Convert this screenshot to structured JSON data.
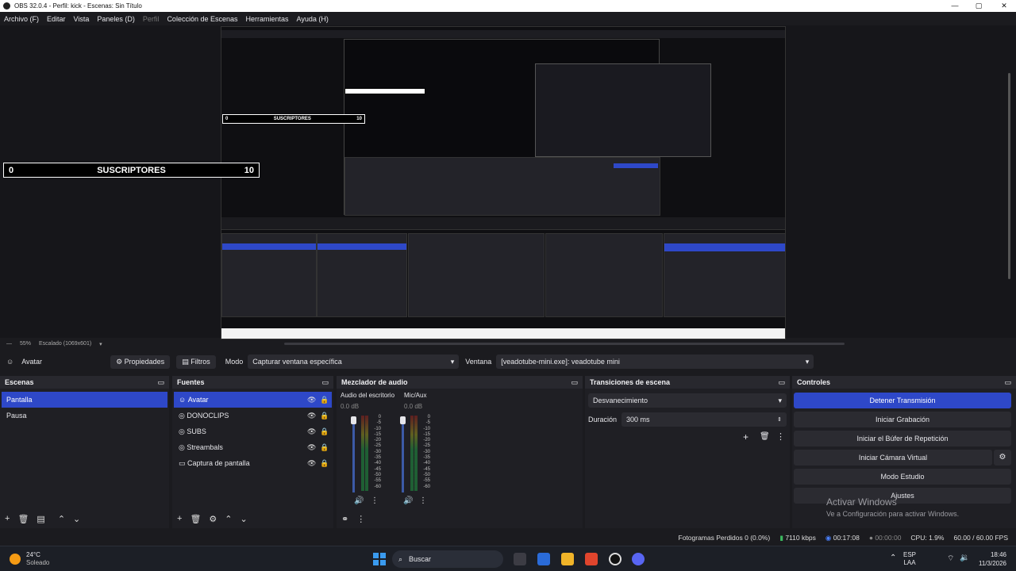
{
  "window": {
    "title": "OBS 32.0.4 - Perfil: kick - Escenas: Sin Título",
    "min": "—",
    "max": "▢",
    "close": "✕"
  },
  "menu": [
    {
      "label": "Archivo (F)"
    },
    {
      "label": "Editar"
    },
    {
      "label": "Vista"
    },
    {
      "label": "Paneles (D)"
    },
    {
      "label": "Perfil"
    },
    {
      "label": "Colección de Escenas"
    },
    {
      "label": "Herramientas"
    },
    {
      "label": "Ayuda (H)"
    }
  ],
  "preview": {
    "subscribers_left": "0",
    "subscribers_label": "SUSCRIPTORES",
    "subscribers_right": "10",
    "zoom": "55%",
    "scaled": "Escalado (1069x601)"
  },
  "source_toolbar": {
    "source_name": "Avatar",
    "properties": "Propiedades",
    "filters": "Filtros",
    "mode_label": "Modo",
    "mode_value": "Capturar ventana específica",
    "window_label": "Ventana",
    "window_value": "[veadotube-mini.exe]: veadotube mini"
  },
  "scenes": {
    "title": "Escenas",
    "items": [
      "Pantalla",
      "Pausa"
    ],
    "selected": 0
  },
  "sources": {
    "title": "Fuentes",
    "items": [
      "Avatar",
      "DONOCLIPS",
      "SUBS",
      "Streambals",
      "Captura de pantalla"
    ],
    "selected": 0
  },
  "mixer": {
    "title": "Mezclador de audio",
    "channels": [
      {
        "name": "Audio del escritorio",
        "db": "0.0 dB"
      },
      {
        "name": "Mic/Aux",
        "db": "0.0 dB"
      }
    ],
    "scale": [
      "0",
      "-5",
      "-10",
      "-15",
      "-20",
      "-25",
      "-30",
      "-35",
      "-40",
      "-45",
      "-50",
      "-55",
      "-60"
    ]
  },
  "transitions": {
    "title": "Transiciones de escena",
    "type": "Desvanecimiento",
    "duration_label": "Duración",
    "duration_value": "300 ms"
  },
  "controls": {
    "title": "Controles",
    "buttons": [
      "Detener Transmisión",
      "Iniciar Grabación",
      "Iniciar el Búfer de Repetición",
      "Iniciar Cámara Virtual",
      "Modo Estudio",
      "Ajustes"
    ]
  },
  "status": {
    "dropped": "Fotogramas Perdidos 0 (0.0%)",
    "bitrate": "7110 kbps",
    "stream_time": "00:17:08",
    "rec_time": "00:00:00",
    "cpu": "CPU: 1.9%",
    "fps": "60.00 / 60.00 FPS"
  },
  "watermark": {
    "line1": "Activar Windows",
    "line2": "Ve a Configuración para activar Windows."
  },
  "taskbar": {
    "temp": "24°C",
    "weather": "Soleado",
    "search": "Buscar",
    "lang1": "ESP",
    "lang2": "LAA",
    "time": "18:46",
    "date": "11/3/2026"
  }
}
